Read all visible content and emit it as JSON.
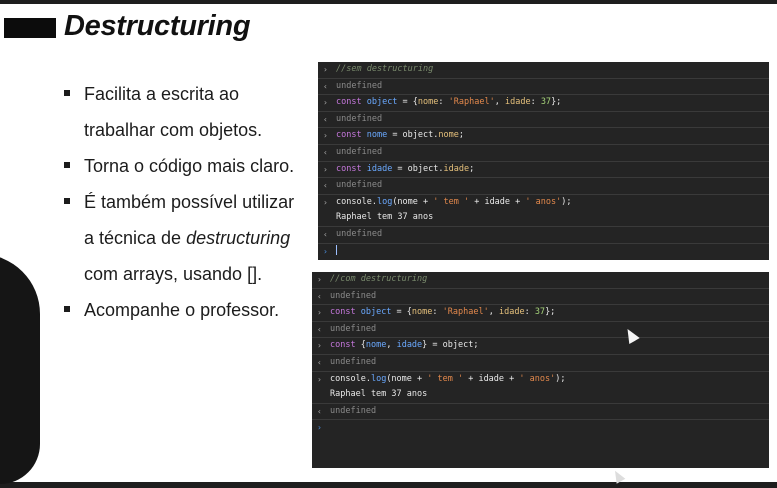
{
  "slide": {
    "title": "Destructuring",
    "bullets": {
      "b1_line1": "Facilita a escrita ao",
      "b1_line2": "trabalhar com objetos.",
      "b2": "Torna o código mais claro.",
      "b3_line1": "É também possível utilizar",
      "b3_line2_a": "a técnica de ",
      "b3_line2_em": "destructuring",
      "b3_line3": "com arrays, usando [].",
      "b4": "Acompanhe o professor."
    }
  },
  "console1": {
    "comment": "//sem destructuring",
    "undefined": "undefined",
    "l1_kw": "const",
    "l1_var": "object",
    "l1_a": " = {",
    "l1_k1": "nome",
    "l1_b": ": ",
    "l1_s1": "'Raphael'",
    "l1_c": ", ",
    "l1_k2": "idade",
    "l1_d": ": ",
    "l1_n": "37",
    "l1_e": "};",
    "l2_kw": "const",
    "l2_var": "nome",
    "l2_a": " = object.",
    "l2_p": "nome",
    "l2_b": ";",
    "l3_kw": "const",
    "l3_var": "idade",
    "l3_a": " = object.",
    "l3_p": "idade",
    "l3_b": ";",
    "l4_a": "console.",
    "l4_fn": "log",
    "l4_b": "(nome + ",
    "l4_s1": "' tem '",
    "l4_c": " + idade + ",
    "l4_s2": "' anos'",
    "l4_d": ");",
    "output": "Raphael tem 37 anos"
  },
  "console2": {
    "comment": "//com destructuring",
    "undefined": "undefined",
    "l1_kw": "const",
    "l1_var": "object",
    "l1_a": " = {",
    "l1_k1": "nome",
    "l1_b": ": ",
    "l1_s1": "'Raphael'",
    "l1_c": ", ",
    "l1_k2": "idade",
    "l1_d": ": ",
    "l1_n": "37",
    "l1_e": "};",
    "l2_kw": "const",
    "l2_a": " {",
    "l2_v1": "nome",
    "l2_b": ", ",
    "l2_v2": "idade",
    "l2_c": "} = object;",
    "l3_a": "console.",
    "l3_fn": "log",
    "l3_b": "(nome + ",
    "l3_s1": "' tem '",
    "l3_c": " + idade + ",
    "l3_s2": "' anos'",
    "l3_d": ");",
    "output": "Raphael tem 37 anos"
  },
  "glyphs": {
    "prompt": "›",
    "result": "‹"
  },
  "icons": [
    "prompt-arrow-icon",
    "result-arrow-icon",
    "mouse-pointer-icon"
  ]
}
